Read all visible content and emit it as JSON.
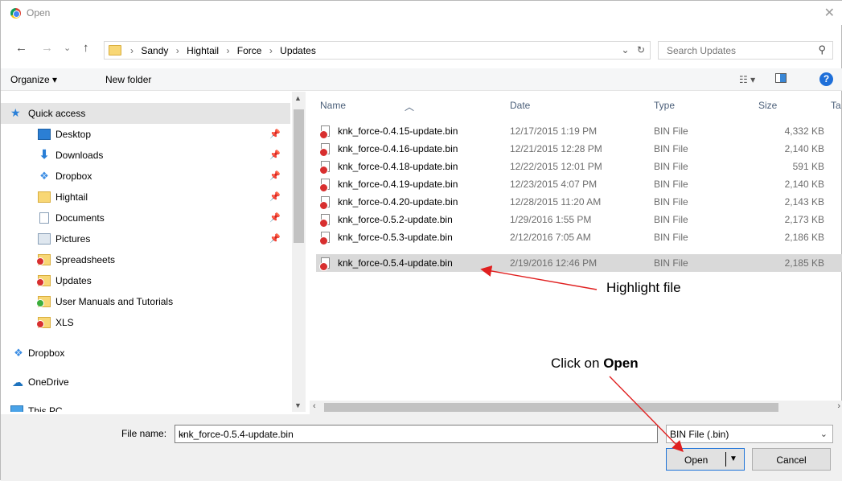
{
  "window": {
    "title": "Open",
    "close_glyph": "✕"
  },
  "nav": {
    "back": "←",
    "forward": "→",
    "recent": "⌄",
    "up": "↑",
    "breadcrumbs": [
      "Sandy",
      "Hightail",
      "Force",
      "Updates"
    ],
    "refresh": "↻",
    "dropdown": "⌄"
  },
  "search": {
    "placeholder": "Search Updates"
  },
  "toolbar": {
    "organize": "Organize ▾",
    "new_folder": "New folder",
    "help": "?"
  },
  "sidebar": {
    "items": [
      {
        "label": "Quick access",
        "icon": "star-icon",
        "pinned": false,
        "selected": true
      },
      {
        "label": "Desktop",
        "icon": "desktop-icon",
        "pinned": true
      },
      {
        "label": "Downloads",
        "icon": "download-icon",
        "pinned": true
      },
      {
        "label": "Dropbox",
        "icon": "dropbox-icon",
        "pinned": true
      },
      {
        "label": "Hightail",
        "icon": "folder-icon",
        "pinned": true
      },
      {
        "label": "Documents",
        "icon": "documents-icon",
        "pinned": true
      },
      {
        "label": "Pictures",
        "icon": "pictures-icon",
        "pinned": true
      },
      {
        "label": "Spreadsheets",
        "icon": "sync-error-folder-icon"
      },
      {
        "label": "Updates",
        "icon": "sync-error-folder-icon"
      },
      {
        "label": "User Manuals and Tutorials",
        "icon": "synced-folder-icon"
      },
      {
        "label": "XLS",
        "icon": "sync-error-folder-icon"
      },
      {
        "label": "Dropbox",
        "icon": "dropbox-icon"
      },
      {
        "label": "OneDrive",
        "icon": "onedrive-icon"
      },
      {
        "label": "This PC",
        "icon": "computer-icon"
      }
    ]
  },
  "filelist": {
    "columns": {
      "name": "Name",
      "date": "Date",
      "type": "Type",
      "size": "Size",
      "tags": "Ta"
    },
    "rows": [
      {
        "name": "knk_force-0.4.15-update.bin",
        "date": "12/17/2015 1:19 PM",
        "type": "BIN File",
        "size": "4,332 KB"
      },
      {
        "name": "knk_force-0.4.16-update.bin",
        "date": "12/21/2015 12:28 PM",
        "type": "BIN File",
        "size": "2,140 KB"
      },
      {
        "name": "knk_force-0.4.18-update.bin",
        "date": "12/22/2015 12:01 PM",
        "type": "BIN File",
        "size": "591 KB"
      },
      {
        "name": "knk_force-0.4.19-update.bin",
        "date": "12/23/2015 4:07 PM",
        "type": "BIN File",
        "size": "2,140 KB"
      },
      {
        "name": "knk_force-0.4.20-update.bin",
        "date": "12/28/2015 11:20 AM",
        "type": "BIN File",
        "size": "2,143 KB"
      },
      {
        "name": "knk_force-0.5.2-update.bin",
        "date": "1/29/2016 1:55 PM",
        "type": "BIN File",
        "size": "2,173 KB"
      },
      {
        "name": "knk_force-0.5.3-update.bin",
        "date": "2/12/2016 7:05 AM",
        "type": "BIN File",
        "size": "2,186 KB"
      },
      {
        "name": "knk_force-0.5.4-update.bin",
        "date": "2/19/2016 12:46 PM",
        "type": "BIN File",
        "size": "2,185 KB",
        "selected": true
      }
    ]
  },
  "footer": {
    "filename_label": "File name:",
    "filename_value": "knk_force-0.5.4-update.bin",
    "filetype_value": "BIN File (.bin)",
    "open_label": "Open",
    "cancel_label": "Cancel"
  },
  "annotations": {
    "highlight": "Highlight file",
    "click_prefix": "Click on ",
    "click_bold": "Open",
    "arrow_color": "#e02020"
  }
}
